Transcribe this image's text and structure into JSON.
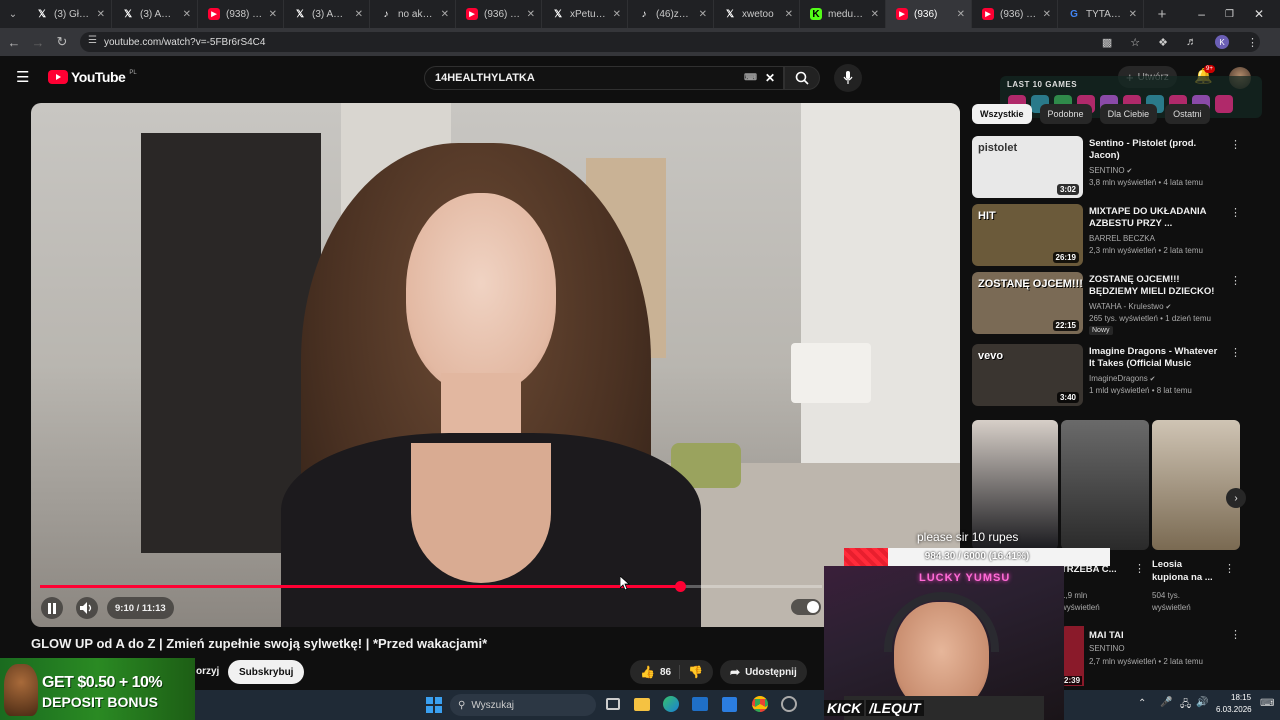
{
  "browser": {
    "tabs": [
      {
        "label": "(3) Główna",
        "icon": "x-logo-icon",
        "color": "#ffffff"
      },
      {
        "label": "(3) Adam",
        "icon": "x-logo-icon",
        "color": "#ffffff"
      },
      {
        "label": "(938) mam",
        "icon": "youtube-icon",
        "color": "#ff0033"
      },
      {
        "label": "(3) Adam",
        "icon": "x-logo-icon",
        "color": "#ffffff"
      },
      {
        "label": "no akurat",
        "icon": "tiktok-icon",
        "color": "#ffffff"
      },
      {
        "label": "(936) YouT",
        "icon": "youtube-icon",
        "color": "#ff0033"
      },
      {
        "label": "xPetu w sc",
        "icon": "x-logo-icon",
        "color": "#ffffff"
      },
      {
        "label": "(46)zaraz",
        "icon": "tiktok-icon",
        "color": "#ffffff"
      },
      {
        "label": "xwetoo",
        "icon": "x-logo-icon",
        "color": "#ffffff"
      },
      {
        "label": "meduska",
        "icon": "kick-icon",
        "color": "#53fc18"
      },
      {
        "label": "(936)",
        "icon": "youtube-icon",
        "color": "#ff0033",
        "active": true
      },
      {
        "label": "(936) 14h",
        "icon": "youtube-icon",
        "color": "#ff0033"
      },
      {
        "label": "TYTAN TI",
        "icon": "google-icon",
        "color": "#4285f4"
      }
    ],
    "url": "youtube.com/watch?v=-5FBr6rS4C4",
    "profile_initial": "K"
  },
  "youtube": {
    "logo": "YouTube",
    "region": "PL",
    "search_query": "14HEALTHYLATKA",
    "create_label": "Utwórz",
    "notif_count": "9+",
    "chips": [
      "Wszystkie",
      "Podobne",
      "Dla Ciebie",
      "Ostatni"
    ]
  },
  "player": {
    "time": "9:10 / 11:13",
    "progress_fraction": 0.818
  },
  "video": {
    "title": "GLOW UP od A do Z | Zmień zupełnie swoją sylwetkę! | *Przed wakacjami*",
    "subscribe_label": "Subskrybuj",
    "channel_partial": "orzyj",
    "like_count": "86",
    "share_label": "Udostępnij"
  },
  "recommendations": [
    {
      "title": "Sentino - Pistolet (prod. Jacon)",
      "channel": "SENTINO",
      "verified": true,
      "meta": "3,8 mln wyświetleń • 4 lata temu",
      "duration": "3:02",
      "thumb_color": "#e8e8e8",
      "thumb_text": "pistolet"
    },
    {
      "title": "MIXTAPE DO UKŁADANIA AZBESTU PRZY ...",
      "channel": "BARREL BECZKA",
      "verified": false,
      "meta": "2,3 mln wyświetleń • 2 lata temu",
      "duration": "26:19",
      "thumb_color": "#6b5a3a",
      "thumb_text": "HIT"
    },
    {
      "title": "ZOSTANĘ OJCEM!!! BĘDZIEMY MIELI DZIECKO!",
      "channel": "WATAHA - Krulestwo",
      "verified": true,
      "meta": "265 tys. wyświetleń • 1 dzień temu",
      "badge": "Nowy",
      "duration": "22:15",
      "thumb_color": "#7a6a55",
      "thumb_text": "ZOSTANĘ OJCEM!!!"
    },
    {
      "title": "Imagine Dragons - Whatever It Takes (Official Music Video)",
      "channel": "ImagineDragons",
      "verified": true,
      "meta": "1 mld wyświetleń • 8 lat temu",
      "duration": "3:40",
      "thumb_color": "#3a3530",
      "thumb_text": "vevo"
    }
  ],
  "shorts": [
    {
      "title": "",
      "views": "",
      "color": "#6a5a4a"
    },
    {
      "title": "TRZEBA C...",
      "views": "1,9 mln wyświetleń",
      "color": "#555555"
    },
    {
      "title": "Leosia kupiona na ...",
      "views": "504 tys. wyświetleń",
      "color": "#8a7a60"
    }
  ],
  "rec_after": {
    "title": "MAI TAI",
    "channel": "SENTINO",
    "verified": true,
    "meta": "2,7 mln wyświetleń • 2 lata temu",
    "duration": "2:39"
  },
  "overlay": {
    "last_games_label": "LAST 10 GAMES",
    "donation_text": "please sir 10 rupes",
    "goal_text": "984.30 / 6000 (16.41%)",
    "goal_fraction": 0.1641,
    "kick_label": "KICK",
    "kick_user": "/LEQUT",
    "webcam_text": "LUCKY YUMSU",
    "ad_line1": "GET $0.50 + 10%",
    "ad_line2": "DEPOSIT BONUS"
  },
  "taskbar": {
    "search_placeholder": "Wyszukaj",
    "time": "18:15",
    "date": "6.03.2026"
  }
}
